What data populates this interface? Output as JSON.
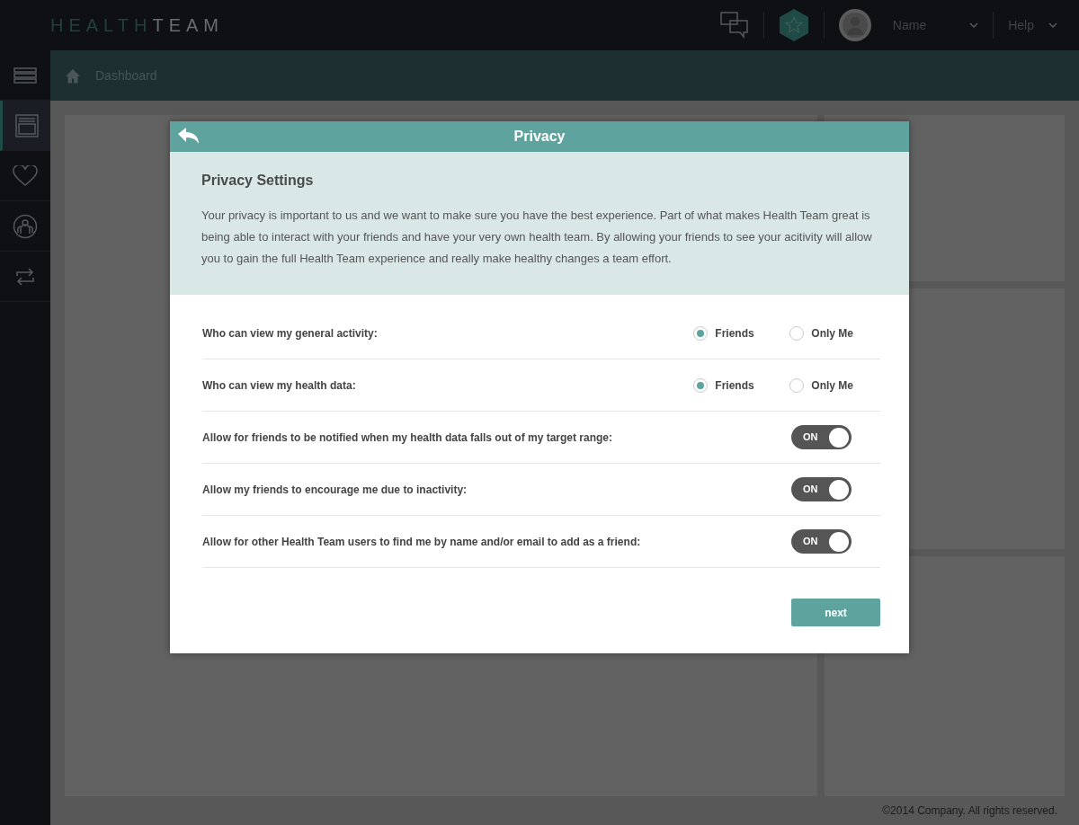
{
  "header": {
    "logo_light": "HEALTH",
    "logo_bold": "TEAM",
    "user": {
      "name": "Name"
    },
    "help": "Help"
  },
  "sidebar": {
    "items": [
      {
        "kind": "menu",
        "selected": false
      },
      {
        "kind": "window",
        "selected": true
      },
      {
        "kind": "heart",
        "selected": false
      },
      {
        "kind": "people",
        "selected": false
      },
      {
        "kind": "swap",
        "selected": false
      }
    ]
  },
  "breadcrumb": "Dashboard",
  "footer": "©2014 Company. All rights reserved.",
  "modal": {
    "title": "Privacy",
    "heading": "Privacy Settings",
    "intro": "Your privacy is important to us and we want to make sure you have the best experience. Part of what makes Health Team great is being able to interact with your friends and have your very own health team. By allowing your friends to see your acitivity will allow you to gain the full Health Team experience and really make healthy changes a team effort.",
    "settings": [
      {
        "kind": "radio",
        "label": "Who can view my general activity:",
        "options": [
          {
            "label": "Friends",
            "selected": true
          },
          {
            "label": "Only Me",
            "selected": false
          }
        ]
      },
      {
        "kind": "radio",
        "label": "Who can view my health data:",
        "options": [
          {
            "label": "Friends",
            "selected": true
          },
          {
            "label": "Only Me",
            "selected": false
          }
        ]
      },
      {
        "kind": "toggle",
        "label": "Allow for friends to be notified when my health data falls out of my target range:",
        "on": true,
        "state_label": "ON"
      },
      {
        "kind": "toggle",
        "label": "Allow my friends to encourage me due to inactivity:",
        "on": true,
        "state_label": "ON"
      },
      {
        "kind": "toggle",
        "label": "Allow for other Health Team users to find me by name and/or email to add as a friend:",
        "on": true,
        "state_label": "ON"
      }
    ],
    "next": "next"
  }
}
